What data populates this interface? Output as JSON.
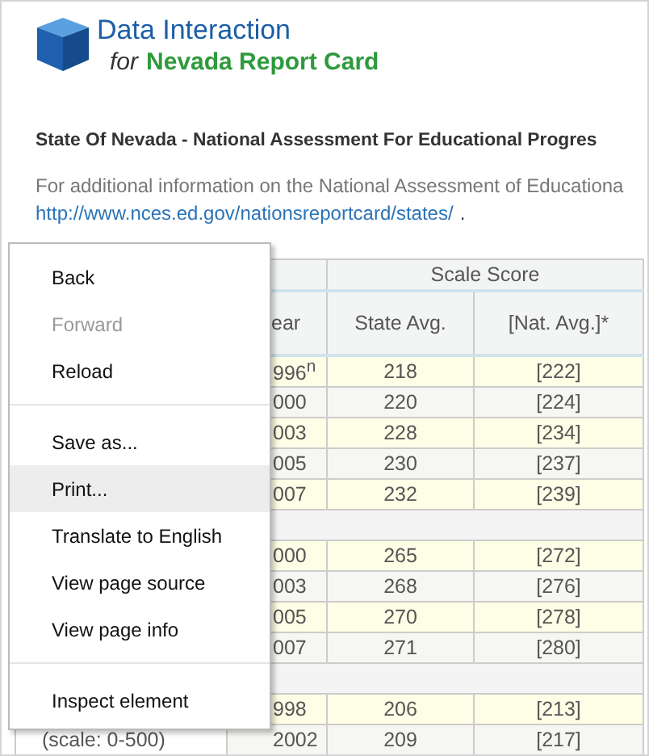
{
  "logo": {
    "title": "Data Interaction",
    "for": "for",
    "subtitle": "Nevada Report Card"
  },
  "heading": "State Of Nevada - National Assessment For Educational Progres",
  "intro": "For additional information on the National Assessment of Educationa",
  "link": "http://www.nces.ed.gov/nationsreportcard/states/",
  "link_suffix": ".",
  "table": {
    "group_header": "Scale Score",
    "columns": [
      "ear",
      "State Avg.",
      "[Nat. Avg.]*"
    ],
    "groups": [
      {
        "rows": [
          {
            "year": "996$^{n}$",
            "state": "218",
            "nat": "[222]"
          },
          {
            "year": "000",
            "state": "220",
            "nat": "[224]"
          },
          {
            "year": "003",
            "state": "228",
            "nat": "[234]"
          },
          {
            "year": "005",
            "state": "230",
            "nat": "[237]"
          },
          {
            "year": "007",
            "state": "232",
            "nat": "[239]"
          }
        ]
      },
      {
        "rows": [
          {
            "year": "000",
            "state": "265",
            "nat": "[272]"
          },
          {
            "year": "003",
            "state": "268",
            "nat": "[276]"
          },
          {
            "year": "005",
            "state": "270",
            "nat": "[278]"
          },
          {
            "year": "007",
            "state": "271",
            "nat": "[280]"
          }
        ]
      },
      {
        "rows": [
          {
            "year": "998",
            "state": "206",
            "nat": "[213]"
          },
          {
            "label": "(scale: 0-500)",
            "year": "2002",
            "state": "209",
            "nat": "[217]"
          }
        ]
      }
    ]
  },
  "context_menu": [
    {
      "kind": "item",
      "label": "Back",
      "disabled": false,
      "selected": false
    },
    {
      "kind": "item",
      "label": "Forward",
      "disabled": true,
      "selected": false
    },
    {
      "kind": "item",
      "label": "Reload",
      "disabled": false,
      "selected": false
    },
    {
      "kind": "separator"
    },
    {
      "kind": "item",
      "label": "Save as...",
      "disabled": false,
      "selected": false
    },
    {
      "kind": "item",
      "label": "Print...",
      "disabled": false,
      "selected": true
    },
    {
      "kind": "item",
      "label": "Translate to English",
      "disabled": false,
      "selected": false
    },
    {
      "kind": "item",
      "label": "View page source",
      "disabled": false,
      "selected": false
    },
    {
      "kind": "item",
      "label": "View page info",
      "disabled": false,
      "selected": false
    },
    {
      "kind": "separator"
    },
    {
      "kind": "item",
      "label": "Inspect element",
      "disabled": false,
      "selected": false
    }
  ]
}
